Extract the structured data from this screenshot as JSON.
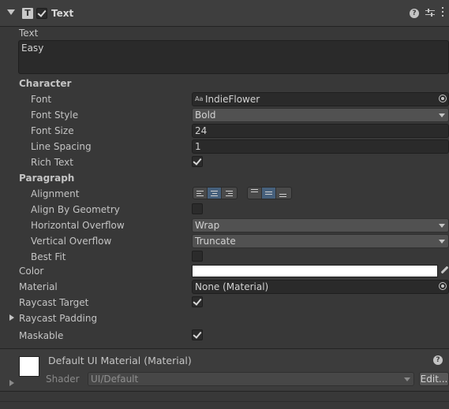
{
  "component": {
    "icon_letter": "T",
    "title": "Text"
  },
  "text_section": {
    "label": "Text",
    "value": "Easy"
  },
  "character": {
    "heading": "Character",
    "font_label": "Font",
    "font_value_icon_text": "Aa",
    "font_value": "IndieFlower",
    "font_style_label": "Font Style",
    "font_style_value": "Bold",
    "font_size_label": "Font Size",
    "font_size_value": "24",
    "line_spacing_label": "Line Spacing",
    "line_spacing_value": "1",
    "rich_text_label": "Rich Text",
    "rich_text_checked": true
  },
  "paragraph": {
    "heading": "Paragraph",
    "alignment_label": "Alignment",
    "horizontal_alignment_selected": "center",
    "vertical_alignment_selected": "middle",
    "align_by_geometry_label": "Align By Geometry",
    "align_by_geometry_checked": false,
    "horizontal_overflow_label": "Horizontal Overflow",
    "horizontal_overflow_value": "Wrap",
    "vertical_overflow_label": "Vertical Overflow",
    "vertical_overflow_value": "Truncate",
    "best_fit_label": "Best Fit",
    "best_fit_checked": false
  },
  "color": {
    "label": "Color",
    "value": "#ffffff"
  },
  "material": {
    "label": "Material",
    "value": "None (Material)"
  },
  "raycast_target": {
    "label": "Raycast Target",
    "checked": true
  },
  "raycast_padding": {
    "label": "Raycast Padding"
  },
  "maskable": {
    "label": "Maskable",
    "checked": true
  },
  "default_material": {
    "title": "Default UI Material (Material)",
    "shader_label": "Shader",
    "shader_value": "UI/Default",
    "edit_label": "Edit..."
  },
  "colors": {
    "panel_bg": "#383838",
    "header_bg": "#3e3e3e",
    "selected_toggle": "#46607c",
    "text": "#c4c4c4"
  }
}
